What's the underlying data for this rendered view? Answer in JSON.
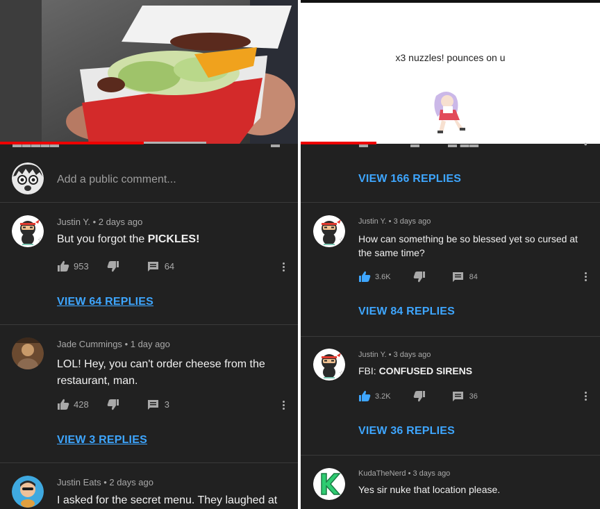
{
  "left": {
    "add_comment_placeholder": "Add a public comment...",
    "comments": [
      {
        "author": "Justin Y.",
        "time": "2 days ago",
        "text_pre": "But you forgot the ",
        "text_bold": "PICKLES!",
        "likes": "953",
        "replies_count": "64",
        "view_replies": "VIEW 64 REPLIES"
      },
      {
        "author": "Jade Cummings",
        "time": "1 day ago",
        "text_line1": "LOL! Hey, you can't order cheese from the",
        "text_line2": "restaurant, man.",
        "likes": "428",
        "replies_count": "3",
        "view_replies": "VIEW 3 REPLIES"
      },
      {
        "author": "Justin Eats",
        "time": "2 days ago",
        "text_line1": "I asked for the secret menu. They laughed at"
      }
    ]
  },
  "right": {
    "video_caption": "x3 nuzzles! pounces on u",
    "top_view_replies": "VIEW 166 REPLIES",
    "comments": [
      {
        "author": "Justin Y.",
        "time": "3 days ago",
        "text_line1": "How can something be so blessed yet so cursed at",
        "text_line2": "the same time?",
        "likes": "3.6K",
        "replies_count": "84",
        "view_replies": "VIEW 84 REPLIES"
      },
      {
        "author": "Justin Y.",
        "time": "3 days ago",
        "text_pre": "FBI: ",
        "text_bold": "CONFUSED SIRENS",
        "likes": "3.2K",
        "replies_count": "36",
        "view_replies": "VIEW 36 REPLIES"
      },
      {
        "author": "KudaTheNerd",
        "time": "3 days ago",
        "text_line1": "Yes sir nuke that location please."
      }
    ]
  },
  "colors": {
    "background": "#212121",
    "link_blue": "#3ea6ff",
    "progress_red": "#ee0000",
    "text_primary": "#f1f1f1",
    "text_secondary": "#a9a9a9"
  },
  "icons": [
    "thumbs-up-icon",
    "thumbs-down-icon",
    "reply-icon",
    "more-vert-icon"
  ]
}
